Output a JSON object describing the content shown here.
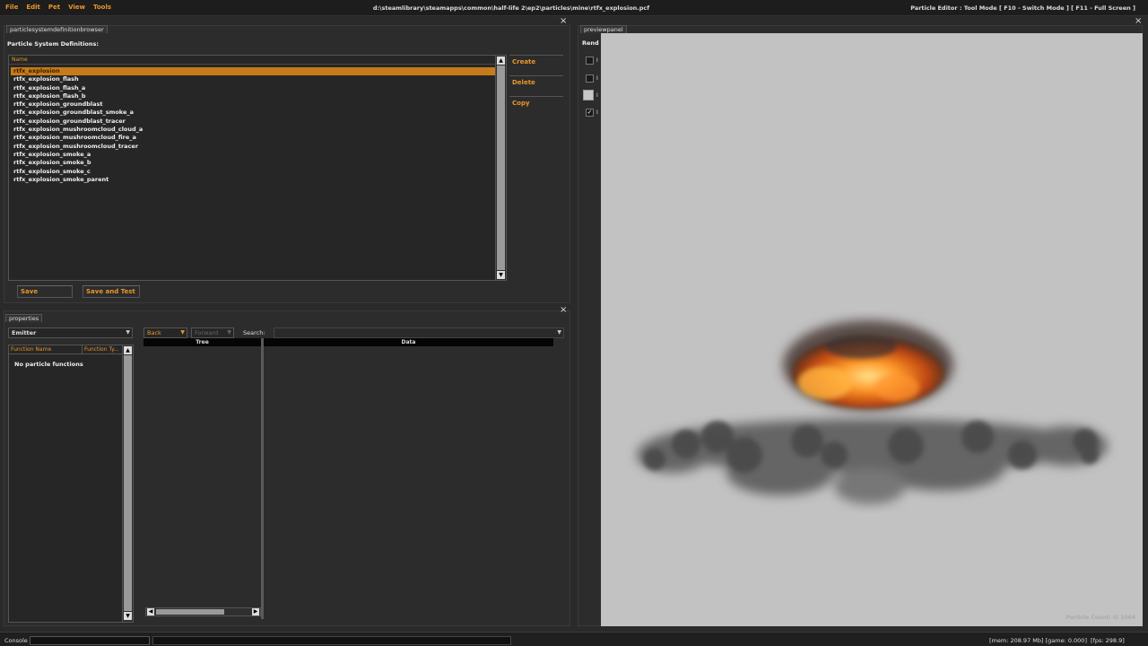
{
  "menubar": {
    "items": [
      "File",
      "Edit",
      "Pet",
      "View",
      "Tools"
    ],
    "filepath": "d:\\steamlibrary\\steamapps\\common\\half-life 2\\ep2\\particles\\mine\\rtfx_explosion.pcf",
    "mode_info": "Particle Editor : Tool Mode [ F10 - Switch Mode ] [ F11 - Full Screen ]"
  },
  "browser": {
    "tab": "particlesystemdefinitionbrowser",
    "title": "Particle System Definitions:",
    "column_name": "Name",
    "items": [
      "rtfx_explosion",
      "rtfx_explosion_flash",
      "rtfx_explosion_flash_a",
      "rtfx_explosion_flash_b",
      "rtfx_explosion_groundblast",
      "rtfx_explosion_groundblast_smoke_a",
      "rtfx_explosion_groundblast_tracer",
      "rtfx_explosion_mushroomcloud_cloud_a",
      "rtfx_explosion_mushroomcloud_fire_a",
      "rtfx_explosion_mushroomcloud_tracer",
      "rtfx_explosion_smoke_a",
      "rtfx_explosion_smoke_b",
      "rtfx_explosion_smoke_c",
      "rtfx_explosion_smoke_parent"
    ],
    "selected_index": 0,
    "create_label": "Create",
    "delete_label": "Delete",
    "copy_label": "Copy",
    "save_label": "Save",
    "save_and_test_label": "Save and Test"
  },
  "properties": {
    "tab": "properties",
    "type_selected": "Emitter",
    "col_function_name": "Function Name",
    "col_function_type": "Function Ty...",
    "empty_message": "No particle functions",
    "back_label": "Back",
    "forward_label": "Forward",
    "search_label": "Search:",
    "search_value": "",
    "col_tree": "Tree",
    "col_data": "Data"
  },
  "preview": {
    "tab": "previewpanel",
    "render_label": "Rend",
    "checkboxes": [
      {
        "label": "I",
        "checked": false
      },
      {
        "label": "I",
        "checked": false
      },
      {
        "label": "I",
        "checked": false
      },
      {
        "label": "I",
        "checked": true
      }
    ],
    "particle_count": "Particle Count:   0/ 1004"
  },
  "status": {
    "console_label": "Console",
    "mem": "[mem: 208.97 Mb] [game: 0.000]",
    "fps": "[fps:  298.9]"
  },
  "colors": {
    "accent": "#e8962b",
    "selection": "#c77a18",
    "viewport_bg": "#c2c2c2"
  }
}
